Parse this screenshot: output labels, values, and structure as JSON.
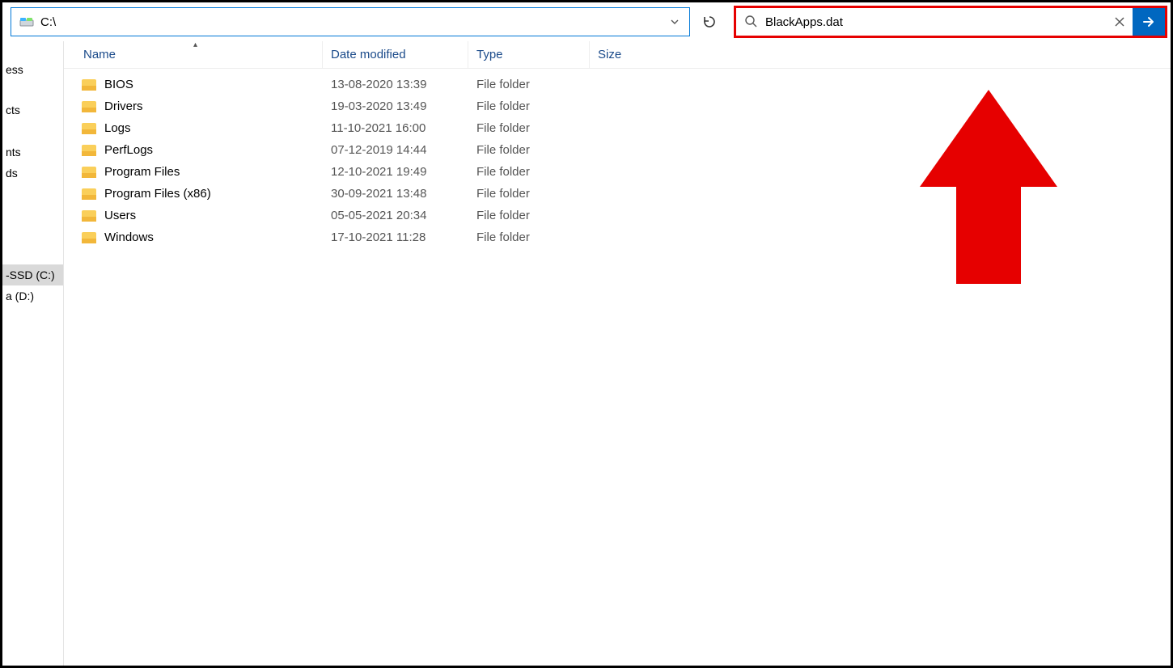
{
  "address": {
    "path": "C:\\",
    "drive_label": "C:"
  },
  "search": {
    "query": "BlackApps.dat"
  },
  "columns": {
    "name": "Name",
    "date_modified": "Date modified",
    "type": "Type",
    "size": "Size"
  },
  "nav": {
    "group_a": [
      {
        "label_fragment": "ess"
      }
    ],
    "group_b": [
      {
        "label_fragment": "cts"
      },
      {
        "label_fragment": ""
      },
      {
        "label_fragment": "nts"
      },
      {
        "label_fragment": "ds"
      }
    ],
    "group_c": [
      {
        "label_fragment": "-SSD (C:)",
        "selected": true
      },
      {
        "label_fragment": "a (D:)"
      }
    ]
  },
  "rows": [
    {
      "name": "BIOS",
      "dm": "13-08-2020 13:39",
      "type": "File folder"
    },
    {
      "name": "Drivers",
      "dm": "19-03-2020 13:49",
      "type": "File folder"
    },
    {
      "name": "Logs",
      "dm": "11-10-2021 16:00",
      "type": "File folder"
    },
    {
      "name": "PerfLogs",
      "dm": "07-12-2019 14:44",
      "type": "File folder"
    },
    {
      "name": "Program Files",
      "dm": "12-10-2021 19:49",
      "type": "File folder"
    },
    {
      "name": "Program Files (x86)",
      "dm": "30-09-2021 13:48",
      "type": "File folder"
    },
    {
      "name": "Users",
      "dm": "05-05-2021 20:34",
      "type": "File folder"
    },
    {
      "name": "Windows",
      "dm": "17-10-2021 11:28",
      "type": "File folder"
    }
  ]
}
